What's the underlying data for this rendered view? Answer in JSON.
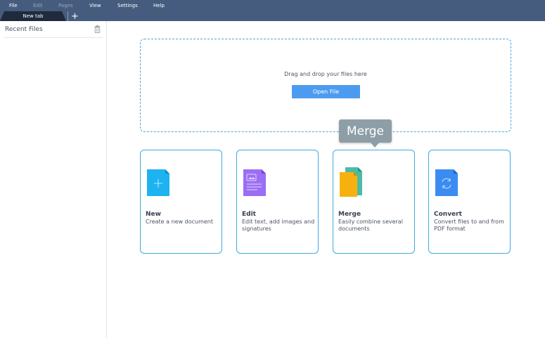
{
  "menu": {
    "file": "File",
    "edit": "Edit",
    "pages": "Pages",
    "view": "View",
    "settings": "Settings",
    "help": "Help"
  },
  "tabs": {
    "active": "New tab",
    "add": "+"
  },
  "sidebar": {
    "title": "Recent Files",
    "icon": "trash-icon"
  },
  "dropzone": {
    "text": "Drag and drop your files here",
    "button": "Open File"
  },
  "cards": [
    {
      "title": "New",
      "desc": "Create a new document",
      "icon": "new-file-icon",
      "color": "#1cb3f0"
    },
    {
      "title": "Edit",
      "desc": "Edit text, add images and signatures",
      "icon": "edit-file-icon",
      "color": "#9b6ef3"
    },
    {
      "title": "Merge",
      "desc": "Easily combine several documents",
      "icon": "merge-files-icon",
      "color": "#f6b10f"
    },
    {
      "title": "Convert",
      "desc": "Convert files to and from PDF format",
      "icon": "convert-file-icon",
      "color": "#3b8cf2"
    }
  ],
  "tooltip": {
    "text": "Merge"
  },
  "colors": {
    "menubar": "#465c7e",
    "accent": "#4d9bf0",
    "card_border": "#42a9e0"
  }
}
